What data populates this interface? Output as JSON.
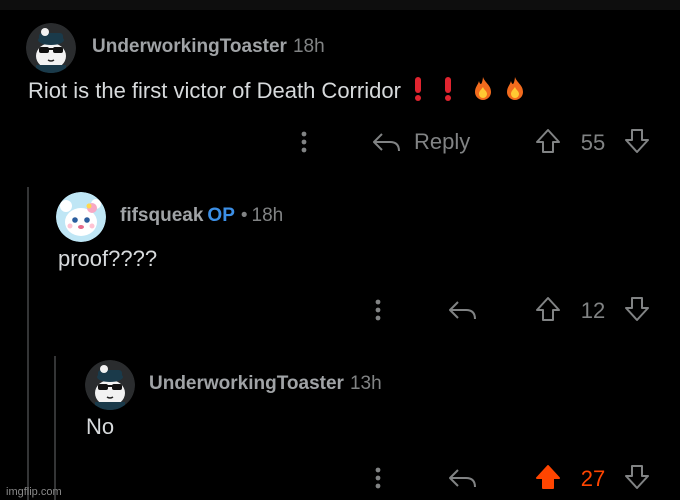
{
  "colors": {
    "background": "#000000",
    "thread_line": "#343536",
    "op_badge": "#3c8fe6",
    "upvote_active": "#ff4500"
  },
  "comments": [
    {
      "author": "UnderworkingToaster",
      "time": "18h",
      "body": "Riot is the first victor of Death Corridor",
      "reply_label": "Reply",
      "score": "55",
      "avatar_icon": "panda-sunglasses-avatar-icon"
    },
    {
      "author": "fifsqueak",
      "op_label": "OP",
      "separator": "•",
      "time": "18h",
      "body": "proof????",
      "score": "12",
      "avatar_icon": "kawaii-cat-avatar-icon"
    },
    {
      "author": "UnderworkingToaster",
      "time": "13h",
      "body": "No",
      "score": "27",
      "upvoted": true,
      "avatar_icon": "panda-sunglasses-avatar-icon"
    }
  ],
  "watermark": "imgflip.com"
}
